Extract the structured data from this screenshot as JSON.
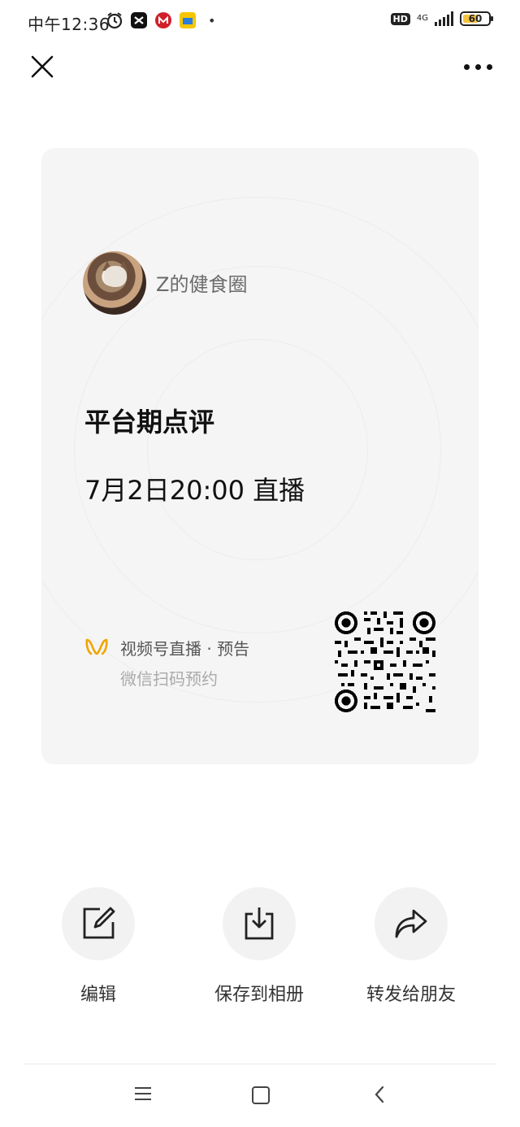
{
  "status_bar": {
    "time": "中午12:36",
    "network": "4G",
    "hd": "HD",
    "battery": "60"
  },
  "nav": {
    "close_icon": "close-icon",
    "more_icon": "more-horizontal-icon"
  },
  "card": {
    "account_name": "Z的健食圈",
    "event_title": "平台期点评",
    "event_time": "7月2日20:00 直播",
    "channel_label": "视频号直播 · 预告",
    "scan_hint": "微信扫码预约",
    "accent_color": "#f0a500"
  },
  "actions": [
    {
      "label": "编辑",
      "icon": "edit-icon"
    },
    {
      "label": "保存到相册",
      "icon": "download-icon"
    },
    {
      "label": "转发给朋友",
      "icon": "share-icon"
    }
  ],
  "system_nav": {
    "menu_icon": "menu-icon",
    "home_icon": "home-icon",
    "back_icon": "back-icon"
  }
}
